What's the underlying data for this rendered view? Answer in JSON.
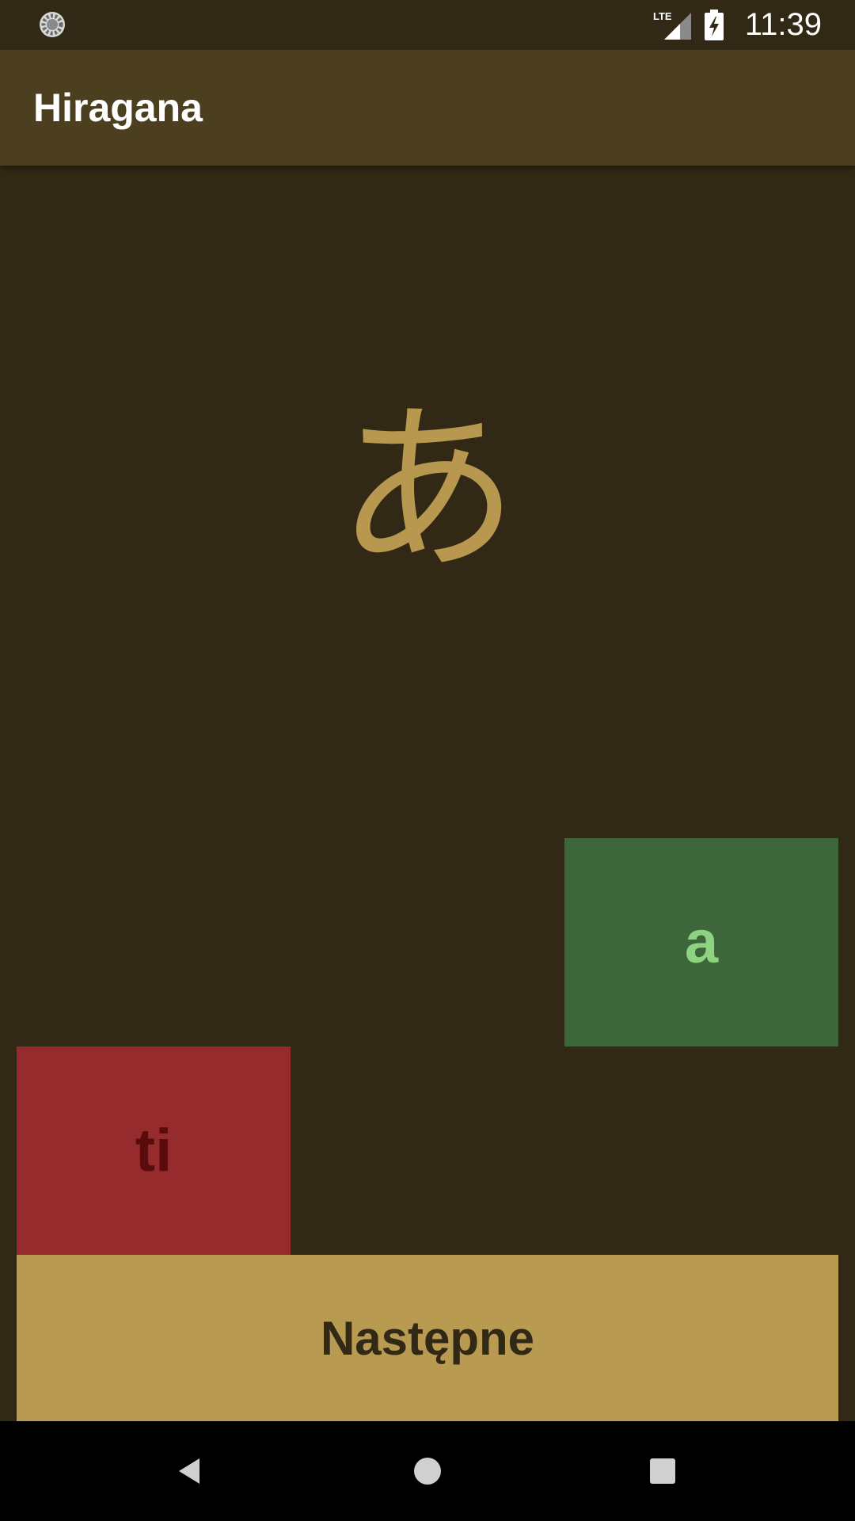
{
  "status_bar": {
    "time": "11:39",
    "network": "LTE",
    "icons": [
      "loading-spinner-icon",
      "lte-signal-icon",
      "battery-charging-icon"
    ]
  },
  "app_bar": {
    "title": "Hiragana"
  },
  "quiz": {
    "character": "あ",
    "answers": {
      "correct": "a",
      "wrong": "ti"
    },
    "next_label": "Następne"
  },
  "nav_bar": {
    "icons": [
      "back-icon",
      "home-icon",
      "recents-icon"
    ]
  },
  "colors": {
    "background": "#312915",
    "app_bar": "#4c3f20",
    "kana": "#b8974f",
    "correct_bg": "#3d673a",
    "correct_text": "#8ed37f",
    "wrong_bg": "#962b2d",
    "wrong_text": "#5a0b0c",
    "button_bg": "#b99a51",
    "button_text": "#312915"
  }
}
